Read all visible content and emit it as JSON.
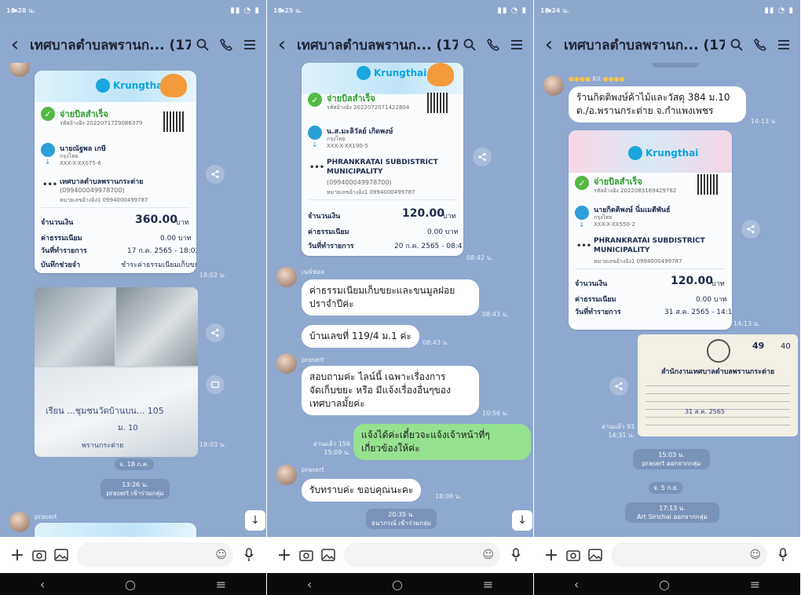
{
  "screens": [
    {
      "status_time": "16:28 น.",
      "title": "เทศบาลตำบลพรานก... (174)",
      "slip": {
        "success": "จ่ายบิลสำเร็จ",
        "ref": "รหัสอ้างอิง 2022071729086379",
        "payer_name": "นายณัฐพล เกษี",
        "payer_bank": "กรุงไทย",
        "payer_acct": "XXX-X-XX075-6",
        "payee_name": "เทศบาลตำบลพรานกระต่าย",
        "payee_id": "(099400049978700)",
        "payee_ref": "หมายเลขอ้างอิง1 0994000499787",
        "amount_label": "จำนวนเงิน",
        "amount": "360.00",
        "fee_label": "ค่าธรรมเนียม",
        "fee": "0.00 บาท",
        "date_label": "วันที่ทำรายการ",
        "date": "17 ก.ค. 2565 - 18:02",
        "note_label": "บันทึกช่วยจำ",
        "note": "ชำระค่าธรรมเนียมเก็บขยะ",
        "baht": "บาท",
        "time": "18:02 น."
      },
      "photo_time": "18:03 น.",
      "photo_text_1": "เรียน ...ชุมชนวัดบ้านบน... 105",
      "photo_text_2": "ม. 10",
      "photo_text_3": "พรานกระต่าย",
      "date_pill": "จ. 18 ก.ค.",
      "join_time": "13:26 น.",
      "join_text": "prasert เข้าร่วมกลุ่ม",
      "next_sender": "prasert"
    },
    {
      "status_time": "16:25 น.",
      "title": "เทศบาลตำบลพรานก... (174)",
      "slip": {
        "success": "จ่ายบิลสำเร็จ",
        "ref": "รหัสอ้างอิง 2022072071422804",
        "payer_name": "น.ส.มะลิวัลย์ เกิดพงษ์",
        "payer_bank": "กรุงไทย",
        "payer_acct": "XXX-X-XX190-5",
        "payee_name": "PHRANKRATAI SUBDISTRICT",
        "payee_name2": "MUNICIPALITY",
        "payee_id": "(099400049978700)",
        "payee_ref": "หมายเลขอ้างอิง1 0994000499787",
        "amount_label": "จำนวนเงิน",
        "amount": "120.00",
        "fee_label": "ค่าธรรมเนียม",
        "fee": "0.00 บาท",
        "date_label": "วันที่ทำรายการ",
        "date": "20 ก.ค. 2565 - 08:41",
        "baht": "บาท",
        "time": "08:42 น."
      },
      "sender1": "เนห์ฟอล",
      "msg1": "ค่าธรรมเนียมเก็บขยะและขนมูลฝอยปราจำปีค่ะ",
      "msg1_line1": "ค่าธรรมเนียมเก็บขยะและขนมูลฝอย",
      "msg1_line2": "ปราจำปีค่ะ",
      "msg1_time": "08:43 น.",
      "msg2": "บ้านเลขที่ 119/4 ม.1 ค่ะ",
      "msg2_time": "08:43 น.",
      "sender2": "prasert",
      "msg3_line1": "สอบถามค่ะ  ไลน์นี้ เฉพาะเรื่องการ",
      "msg3_line2": "จัดเก็บขยะ หรือ มีแจ้งเรื่องอื่นๆของ",
      "msg3_line3": "เทศบาลมั้ยค่ะ",
      "msg3_time": "10:56 น.",
      "reply_read": "อ่านแล้ว 156",
      "reply_time": "15:09 น.",
      "reply_line1": "แจ้งได้ค่ะเดี๋ยวจะแจ้งเจ้าหน้าที่ๆ",
      "reply_line2": "เกี่ยวข้องให้ค่ะ",
      "sender3": "prasert",
      "msg4": "รับทราบค่ะ  ขอบคุณนะคะ",
      "msg4_time": "18:08 น.",
      "join_time": "20:35 น.",
      "join_text": "ธนาภรณ์ เข้าร่วมกลุ่ม"
    },
    {
      "status_time": "16:24 น.",
      "title": "เทศบาลตำบลพรานก... (174)",
      "sender": "Kit",
      "msg_line1": "ร้านกิตติพงษ์ค้าไม้และวัสดุ 384 ม.10",
      "msg_line2": "ต./อ.พรานกระต่าย จ.กำแพงเพชร",
      "msg_time": "14:13 น.",
      "slip": {
        "success": "จ่ายบิลสำเร็จ",
        "ref": "รหัสอ้างอิง 2022083169429782",
        "payer_name": "นายกิตติพงษ์ นิ่มเมตีพันธ์",
        "payer_bank": "กรุงไทย",
        "payer_acct": "XXX-X-XX550-2",
        "payee_name": "PHRANKRATAI SUBDISTRICT",
        "payee_name2": "MUNICIPALITY",
        "payee_ref": "หมายเลขอ้างอิง1 0994000499787",
        "amount_label": "จำนวนเงิน",
        "amount": "120.00",
        "fee_label": "ค่าธรรมเนียม",
        "fee": "0.00 บาท",
        "date_label": "วันที่ทำรายการ",
        "date": "31 ส.ค. 2565 - 14:12",
        "baht": "บาท",
        "time": "14:13 น."
      },
      "receipt_book": "49",
      "receipt_no": "40",
      "receipt_title": "สำนักงานเทศบาลตำบลพรานกระต่าย",
      "receipt_date": "31 ส.ค. 2565",
      "read_text": "อ่านแล้ว 93",
      "read_time": "14:31 น.",
      "leave_time": "15:03 น.",
      "leave_text": "prasert ออกจากกลุ่ม",
      "date_pill": "จ. 5 ก.ย.",
      "leave2_time": "17:13 น.",
      "leave2_text": "Art Sirichai ออกจากกลุ่ม"
    }
  ],
  "brand": "Krungthai",
  "brand_sub": "กรุงไทย",
  "colors": {
    "chat_bg": "#8fa8cf",
    "bubble": "#ffffff",
    "reply": "#95e28f",
    "success": "#55b946"
  }
}
